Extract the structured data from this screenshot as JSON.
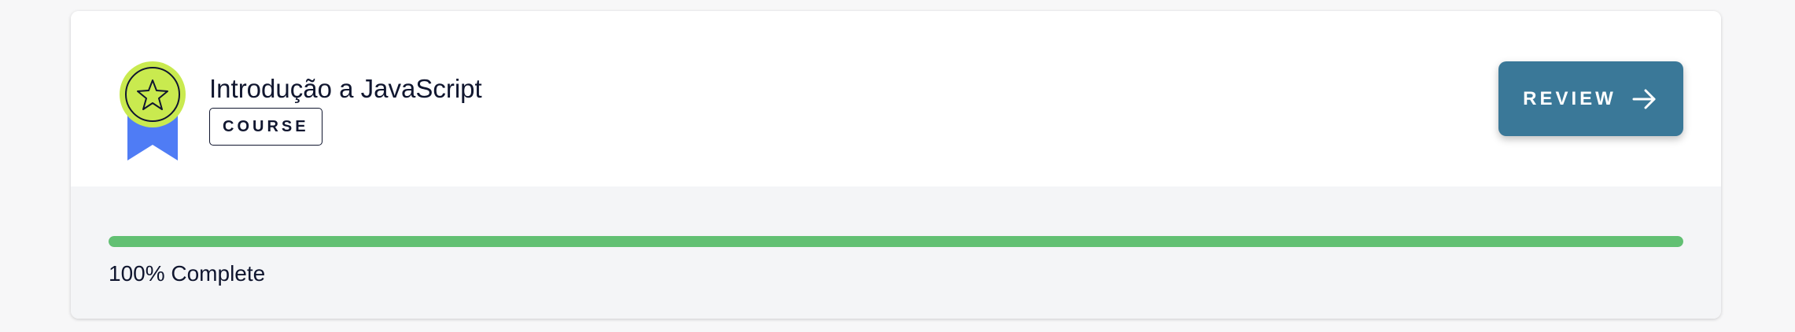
{
  "course": {
    "title": "Introdução a JavaScript",
    "type_label": "COURSE",
    "badge_icon": "award-ribbon-star-icon",
    "action_label": "REVIEW",
    "action_icon": "arrow-right-icon",
    "progress_percent": 100,
    "progress_label": "100% Complete"
  },
  "colors": {
    "button_bg": "#3a7898",
    "progress_fill": "#62c073",
    "badge_circle": "#c9ea4f",
    "badge_ribbon": "#4f7cf5",
    "text": "#10162f"
  }
}
